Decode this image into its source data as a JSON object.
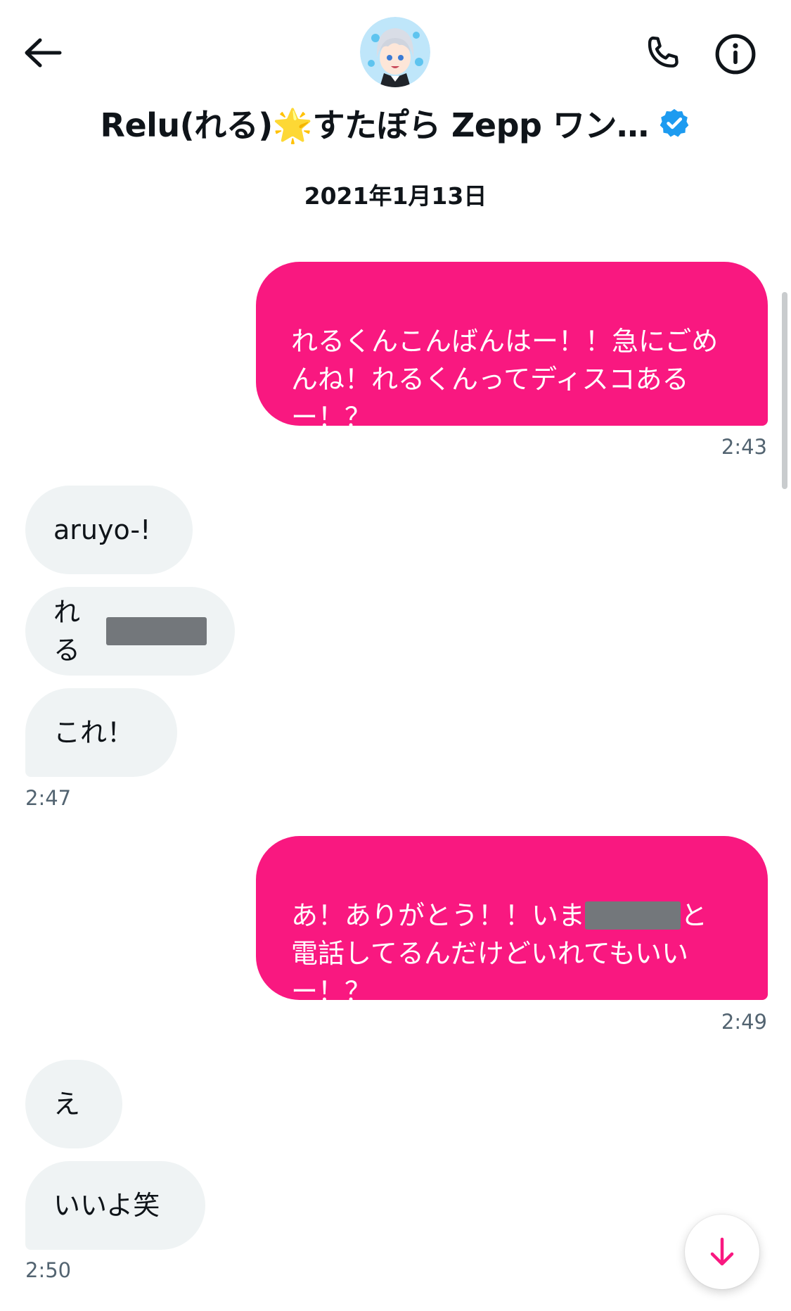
{
  "header": {
    "title": "Relu(れる)🌟すたぽら Zepp ワン…",
    "back_icon": "arrow-left-icon",
    "call_icon": "phone-icon",
    "info_icon": "info-circle-icon",
    "verified_icon": "verified-badge-icon"
  },
  "date_separator": "2021年1月13日",
  "messages": {
    "m1": {
      "text": "れるくんこんばんはー！！急にごめんね！れるくんってディスコあるー！？",
      "time": "2:43"
    },
    "m2": {
      "text": "aruyo-!"
    },
    "m3": {
      "text": "れる"
    },
    "m4": {
      "text": "これ！",
      "time": "2:47"
    },
    "m5": {
      "text_before": "あ！ありがとう！！いま",
      "text_after": "と電話してるんだけどいれてもいいー！？",
      "time": "2:49"
    },
    "m6": {
      "text": "え"
    },
    "m7": {
      "text": "いいよ笑",
      "time": "2:50"
    }
  },
  "scroll_down_icon": "arrow-down-icon",
  "colors": {
    "sent_bubble": "#f91880",
    "received_bubble": "#eff3f4",
    "verified": "#1d9bf0",
    "timestamp": "#536471"
  }
}
